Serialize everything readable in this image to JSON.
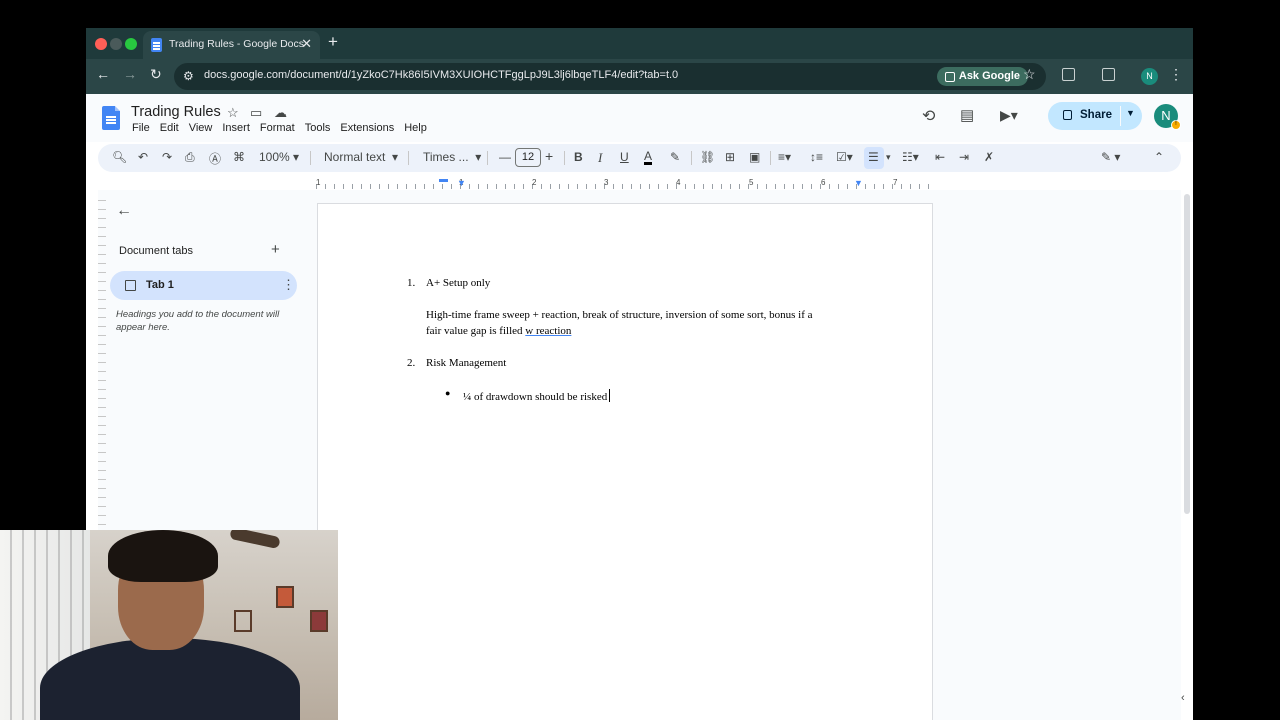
{
  "browser": {
    "tab_title": "Trading Rules - Google Docs",
    "url": "docs.google.com/document/d/1yZkoC7Hk86I5IVM3XUIOHCTFggLpJ9L3lj6lbqeTLF4/edit?tab=t.0",
    "ask_google_label": "Ask Google",
    "profile_initial": "N"
  },
  "doc": {
    "title": "Trading Rules",
    "menu": [
      "File",
      "Edit",
      "View",
      "Insert",
      "Format",
      "Tools",
      "Extensions",
      "Help"
    ],
    "share_label": "Share",
    "user_initial": "N"
  },
  "toolbar": {
    "zoom": "100%",
    "style": "Normal text",
    "font": "Times ...",
    "font_size": "12"
  },
  "ruler": [
    "1",
    "1",
    "2",
    "3",
    "4",
    "5",
    "6",
    "7"
  ],
  "sidebar": {
    "heading": "Document tabs",
    "tab_label": "Tab 1",
    "hint": "Headings you add to the document will appear here."
  },
  "content": {
    "item1_num": "1.",
    "item1": "A+ Setup only",
    "para_line1": "High-time frame sweep + reaction,  break of structure, inversion of some sort, bonus if a",
    "para_line2a": "fair value gap is filled ",
    "para_line2b": "w reaction",
    "item2_num": "2.",
    "item2": "Risk Management",
    "bullet": "¼ of drawdown should be risked"
  },
  "colors": {
    "share_bg": "#c2e7ff",
    "tab_selected": "#d3e3fd",
    "browser_frame": "#2b4647"
  }
}
